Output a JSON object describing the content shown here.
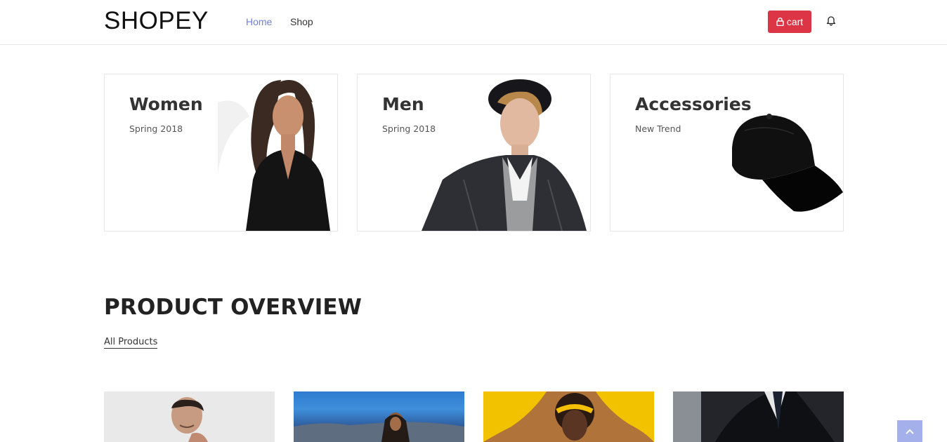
{
  "header": {
    "logo": "SHOPEY",
    "nav": [
      {
        "label": "Home",
        "active": true
      },
      {
        "label": "Shop",
        "active": false
      }
    ],
    "cart_label": "cart",
    "cart_icon": "lock-icon",
    "bell_icon": "bell-icon",
    "accent_color": "#717fe0",
    "cart_color": "#dc3545"
  },
  "banners": [
    {
      "title": "Women",
      "subtitle": "Spring 2018",
      "image": "woman-model-image"
    },
    {
      "title": "Men",
      "subtitle": "Spring 2018",
      "image": "man-model-image"
    },
    {
      "title": "Accessories",
      "subtitle": "New Trend",
      "image": "black-cap-image"
    }
  ],
  "overview": {
    "title": "PRODUCT OVERVIEW",
    "link": "All Products"
  },
  "products": [
    {
      "image": "man-portrait-image"
    },
    {
      "image": "woman-seaside-image"
    },
    {
      "image": "woman-yellow-dress-image"
    },
    {
      "image": "man-suit-image"
    }
  ],
  "back_to_top_icon": "chevron-up-icon"
}
